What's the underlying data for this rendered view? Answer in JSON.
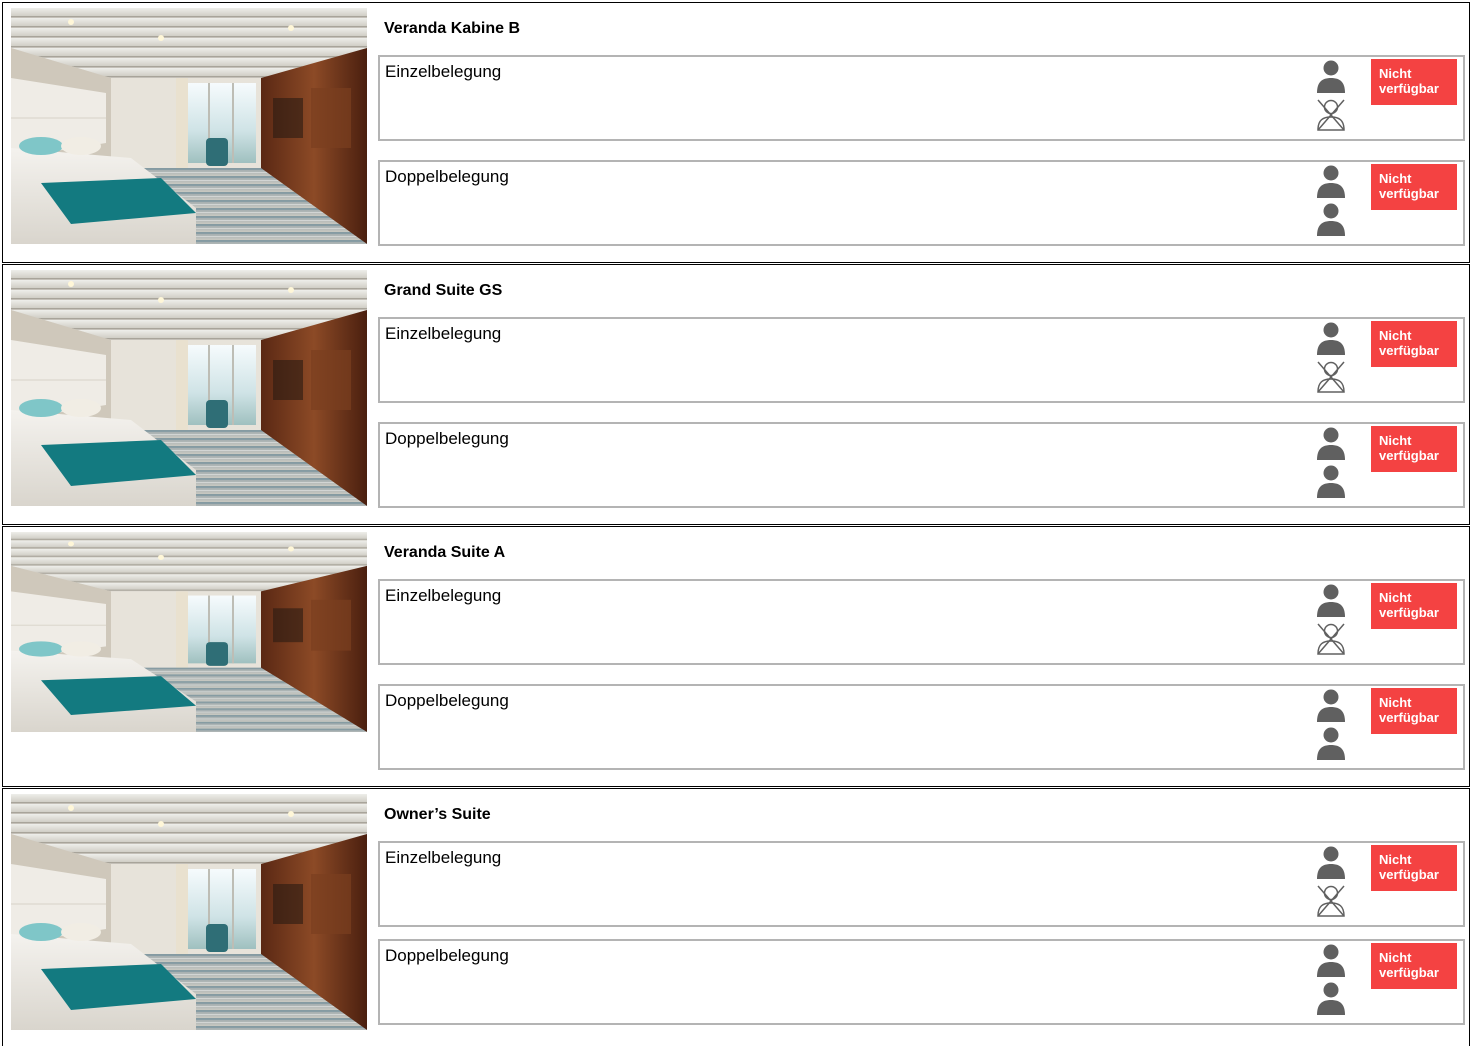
{
  "colors": {
    "status_unavailable": "#f44242",
    "person_icon": "#606060",
    "border": "#b4b4b4"
  },
  "cabins": [
    {
      "name": "Veranda Kabine B",
      "photo": "cabin-photo-veranda-kabine-b",
      "options": [
        {
          "label": "Einzelbelegung",
          "icons": [
            "person-icon",
            "no-person-icon"
          ],
          "status": "Nicht verfügbar"
        },
        {
          "label": "Doppelbelegung",
          "icons": [
            "person-icon",
            "person-icon"
          ],
          "status": "Nicht verfügbar"
        }
      ]
    },
    {
      "name": "Grand Suite GS",
      "photo": "cabin-photo-grand-suite-gs",
      "options": [
        {
          "label": "Einzelbelegung",
          "icons": [
            "person-icon",
            "no-person-icon"
          ],
          "status": "Nicht verfügbar"
        },
        {
          "label": "Doppelbelegung",
          "icons": [
            "person-icon",
            "person-icon"
          ],
          "status": "Nicht verfügbar"
        }
      ]
    },
    {
      "name": "Veranda Suite A",
      "photo": "cabin-photo-veranda-suite-a",
      "options": [
        {
          "label": "Einzelbelegung",
          "icons": [
            "person-icon",
            "no-person-icon"
          ],
          "status": "Nicht verfügbar"
        },
        {
          "label": "Doppelbelegung",
          "icons": [
            "person-icon",
            "person-icon"
          ],
          "status": "Nicht verfügbar"
        }
      ]
    },
    {
      "name": "Owner’s Suite",
      "photo": "cabin-photo-owners-suite",
      "options": [
        {
          "label": "Einzelbelegung",
          "icons": [
            "person-icon",
            "no-person-icon"
          ],
          "status": "Nicht verfügbar"
        },
        {
          "label": "Doppelbelegung",
          "icons": [
            "person-icon",
            "person-icon"
          ],
          "status": "Nicht verfügbar"
        }
      ]
    }
  ]
}
